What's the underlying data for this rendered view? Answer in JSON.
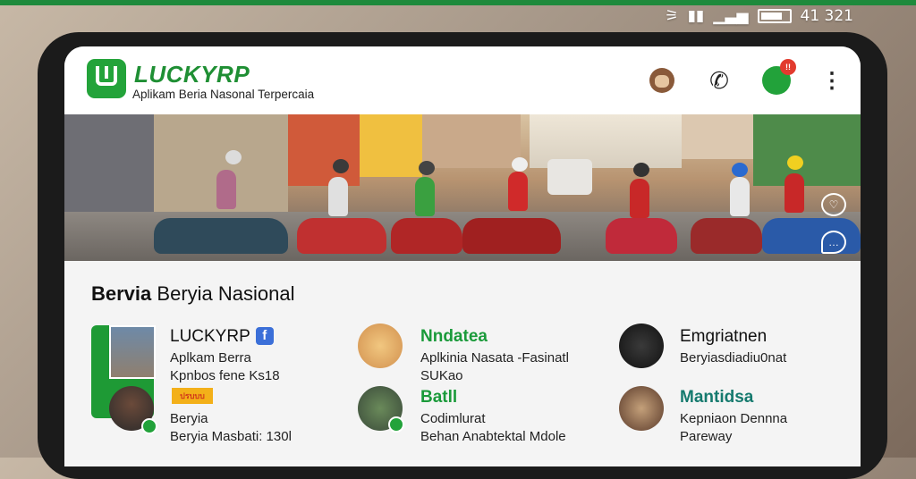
{
  "status": {
    "time": "41 321"
  },
  "app": {
    "title": "LUCKYRP",
    "subtitle": "Aplikam Beria Nasonal Terpercaia"
  },
  "header_icons": {
    "notification_count": "!!"
  },
  "banner": {
    "description_icons": [
      "heart-icon",
      "chat-icon"
    ]
  },
  "section": {
    "title_bold": "Bervia",
    "title_rest": "Beryia Nasional"
  },
  "items": [
    {
      "title": "LUCKYRP",
      "line1": "Aplkam Berra",
      "line2": "Kpnbos fene Ks18"
    },
    {
      "title": "Beryia",
      "line1": "Beryia Masbati: 130l",
      "tag": "ปรบบบ"
    },
    {
      "title": "Nndatea",
      "line1": "Aplkinia Nasata -Fasinatl",
      "line2": "SUKao"
    },
    {
      "title": "Batll",
      "line1": "Codimlurat",
      "line2": "Behan Anabtektal Mdole"
    },
    {
      "title": "Emgriatnen",
      "line1": "Beryiasdiadiu0nat"
    },
    {
      "title": "Mantidsa",
      "line1": "Kepniaon Dennna",
      "line2": "Pareway"
    }
  ],
  "colors": {
    "brand": "#1f8f34",
    "accent_red": "#e23b2e",
    "teal": "#157a6e"
  }
}
